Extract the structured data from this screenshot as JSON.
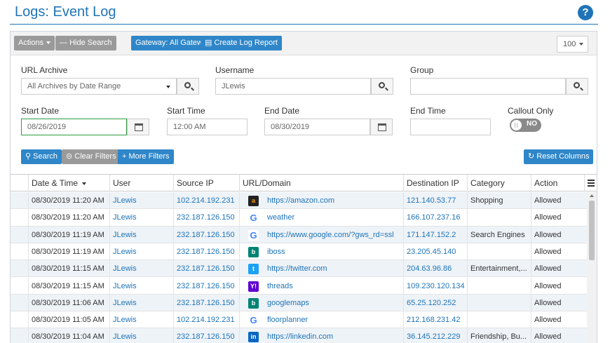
{
  "title": "Logs: Event Log",
  "help_glyph": "?",
  "toolbar": {
    "actions": "Actions",
    "hide_search": "Hide Search",
    "gateway": "Gateway: All Gateways",
    "create_report": "Create Log Report",
    "page_size": "100"
  },
  "filters": {
    "url_archive_label": "URL Archive",
    "url_archive_value": "All Archives by Date Range",
    "username_label": "Username",
    "username_value": "JLewis",
    "group_label": "Group",
    "group_value": "",
    "start_date_label": "Start Date",
    "start_date_value": "08/26/2019",
    "start_time_label": "Start Time",
    "start_time_placeholder": "12:00 AM",
    "end_date_label": "End Date",
    "end_date_value": "08/30/2019",
    "end_time_label": "End Time",
    "end_time_value": "",
    "callout_label": "Callout Only",
    "callout_toggle": "NO"
  },
  "actions": {
    "search": "Search",
    "clear_filters": "Clear Filters",
    "more_filters": "More Filters",
    "reset_columns": "Reset Columns"
  },
  "table": {
    "columns": [
      "Date & Time",
      "User",
      "Source IP",
      "URL/Domain",
      "Destination IP",
      "Category",
      "Action"
    ],
    "rows": [
      {
        "datetime": "08/30/2019 11:20 AM",
        "user": "JLewis",
        "source_ip": "102.214.192.231",
        "icon": "amazon-icon",
        "url": "https://amazon.com",
        "dest_ip": "121.140.53.77",
        "category": "Shopping",
        "action": "Allowed"
      },
      {
        "datetime": "08/30/2019 11:20 AM",
        "user": "JLewis",
        "source_ip": "232.187.126.150",
        "icon": "google-icon",
        "url": "weather",
        "dest_ip": "166.107.237.16",
        "category": "",
        "action": "Allowed"
      },
      {
        "datetime": "08/30/2019 11:19 AM",
        "user": "JLewis",
        "source_ip": "232.187.126.150",
        "icon": "google-icon",
        "url": "https://www.google.com/?gws_rd=ssl",
        "dest_ip": "171.147.152.2",
        "category": "Search Engines",
        "action": "Allowed"
      },
      {
        "datetime": "08/30/2019 11:19 AM",
        "user": "JLewis",
        "source_ip": "232.187.126.150",
        "icon": "bing-icon",
        "url": "iboss",
        "dest_ip": "23.205.45.140",
        "category": "",
        "action": "Allowed"
      },
      {
        "datetime": "08/30/2019 11:15 AM",
        "user": "JLewis",
        "source_ip": "232.187.126.150",
        "icon": "twitter-icon",
        "url": "https://twitter.com",
        "dest_ip": "204.63.96.86",
        "category": "Entertainment,...",
        "action": "Allowed"
      },
      {
        "datetime": "08/30/2019 11:15 AM",
        "user": "JLewis",
        "source_ip": "232.187.126.150",
        "icon": "yahoo-icon",
        "url": "threads",
        "dest_ip": "109.230.120.134",
        "category": "",
        "action": "Allowed"
      },
      {
        "datetime": "08/30/2019 11:06 AM",
        "user": "JLewis",
        "source_ip": "232.187.126.150",
        "icon": "bing-icon",
        "url": "googlemaps",
        "dest_ip": "65.25.120.252",
        "category": "",
        "action": "Allowed"
      },
      {
        "datetime": "08/30/2019 11:05 AM",
        "user": "JLewis",
        "source_ip": "102.214.192.231",
        "icon": "google-icon",
        "url": "floorplanner",
        "dest_ip": "212.168.231.42",
        "category": "",
        "action": "Allowed"
      },
      {
        "datetime": "08/30/2019 11:04 AM",
        "user": "JLewis",
        "source_ip": "232.187.126.150",
        "icon": "linkedin-icon",
        "url": "https://linkedin.com",
        "dest_ip": "36.145.212.229",
        "category": "Friendship, Bu...",
        "action": "Allowed"
      }
    ]
  },
  "colors": {
    "accent": "#1f74b7",
    "button_blue": "#2f86c8",
    "button_grey": "#9a9a9a",
    "row_alt": "#eef3f8"
  }
}
